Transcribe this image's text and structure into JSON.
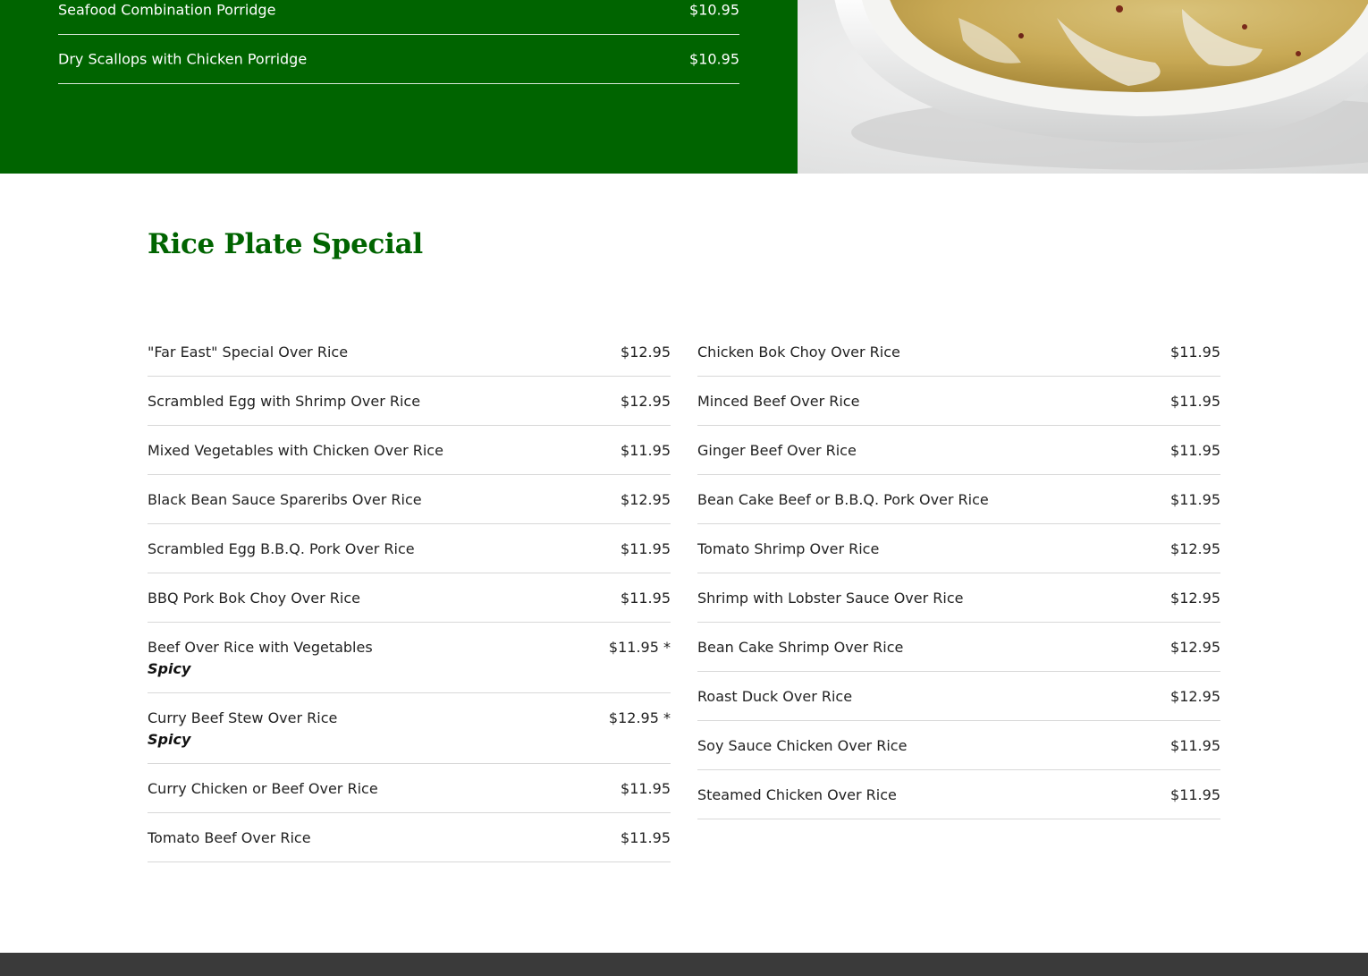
{
  "porridge": {
    "items": [
      {
        "name": "Seafood Combination Porridge",
        "price": "$10.95"
      },
      {
        "name": "Dry Scallops with Chicken Porridge",
        "price": "$10.95"
      }
    ]
  },
  "rice": {
    "title": "Rice Plate Special",
    "left": [
      {
        "name": "\"Far East\" Special Over Rice",
        "price": "$12.95"
      },
      {
        "name": "Scrambled Egg with Shrimp Over Rice",
        "price": "$12.95"
      },
      {
        "name": "Mixed Vegetables with Chicken Over Rice",
        "price": "$11.95"
      },
      {
        "name": "Black Bean Sauce Spareribs Over Rice",
        "price": "$12.95"
      },
      {
        "name": "Scrambled Egg B.B.Q. Pork Over Rice",
        "price": "$11.95"
      },
      {
        "name": "BBQ Pork Bok Choy Over Rice",
        "price": "$11.95"
      },
      {
        "name": "Beef Over Rice with Vegetables",
        "price": "$11.95 *",
        "note": "Spicy"
      },
      {
        "name": "Curry Beef Stew Over Rice",
        "price": "$12.95 *",
        "note": "Spicy"
      },
      {
        "name": "Curry Chicken or Beef Over Rice",
        "price": "$11.95"
      },
      {
        "name": "Tomato Beef Over Rice",
        "price": "$11.95"
      }
    ],
    "right": [
      {
        "name": "Chicken Bok Choy Over Rice",
        "price": "$11.95"
      },
      {
        "name": "Minced Beef Over Rice",
        "price": "$11.95"
      },
      {
        "name": "Ginger Beef Over Rice",
        "price": "$11.95"
      },
      {
        "name": "Bean Cake Beef or B.B.Q. Pork Over Rice",
        "price": "$11.95"
      },
      {
        "name": "Tomato Shrimp Over Rice",
        "price": "$12.95"
      },
      {
        "name": "Shrimp with Lobster Sauce Over Rice",
        "price": "$12.95"
      },
      {
        "name": "Bean Cake Shrimp Over Rice",
        "price": "$12.95"
      },
      {
        "name": "Roast Duck Over Rice",
        "price": "$12.95"
      },
      {
        "name": "Soy Sauce Chicken Over Rice",
        "price": "$11.95"
      },
      {
        "name": "Steamed Chicken Over Rice",
        "price": "$11.95"
      }
    ]
  },
  "colors": {
    "brand_green": "#006400",
    "footer": "#3a3a3a"
  }
}
